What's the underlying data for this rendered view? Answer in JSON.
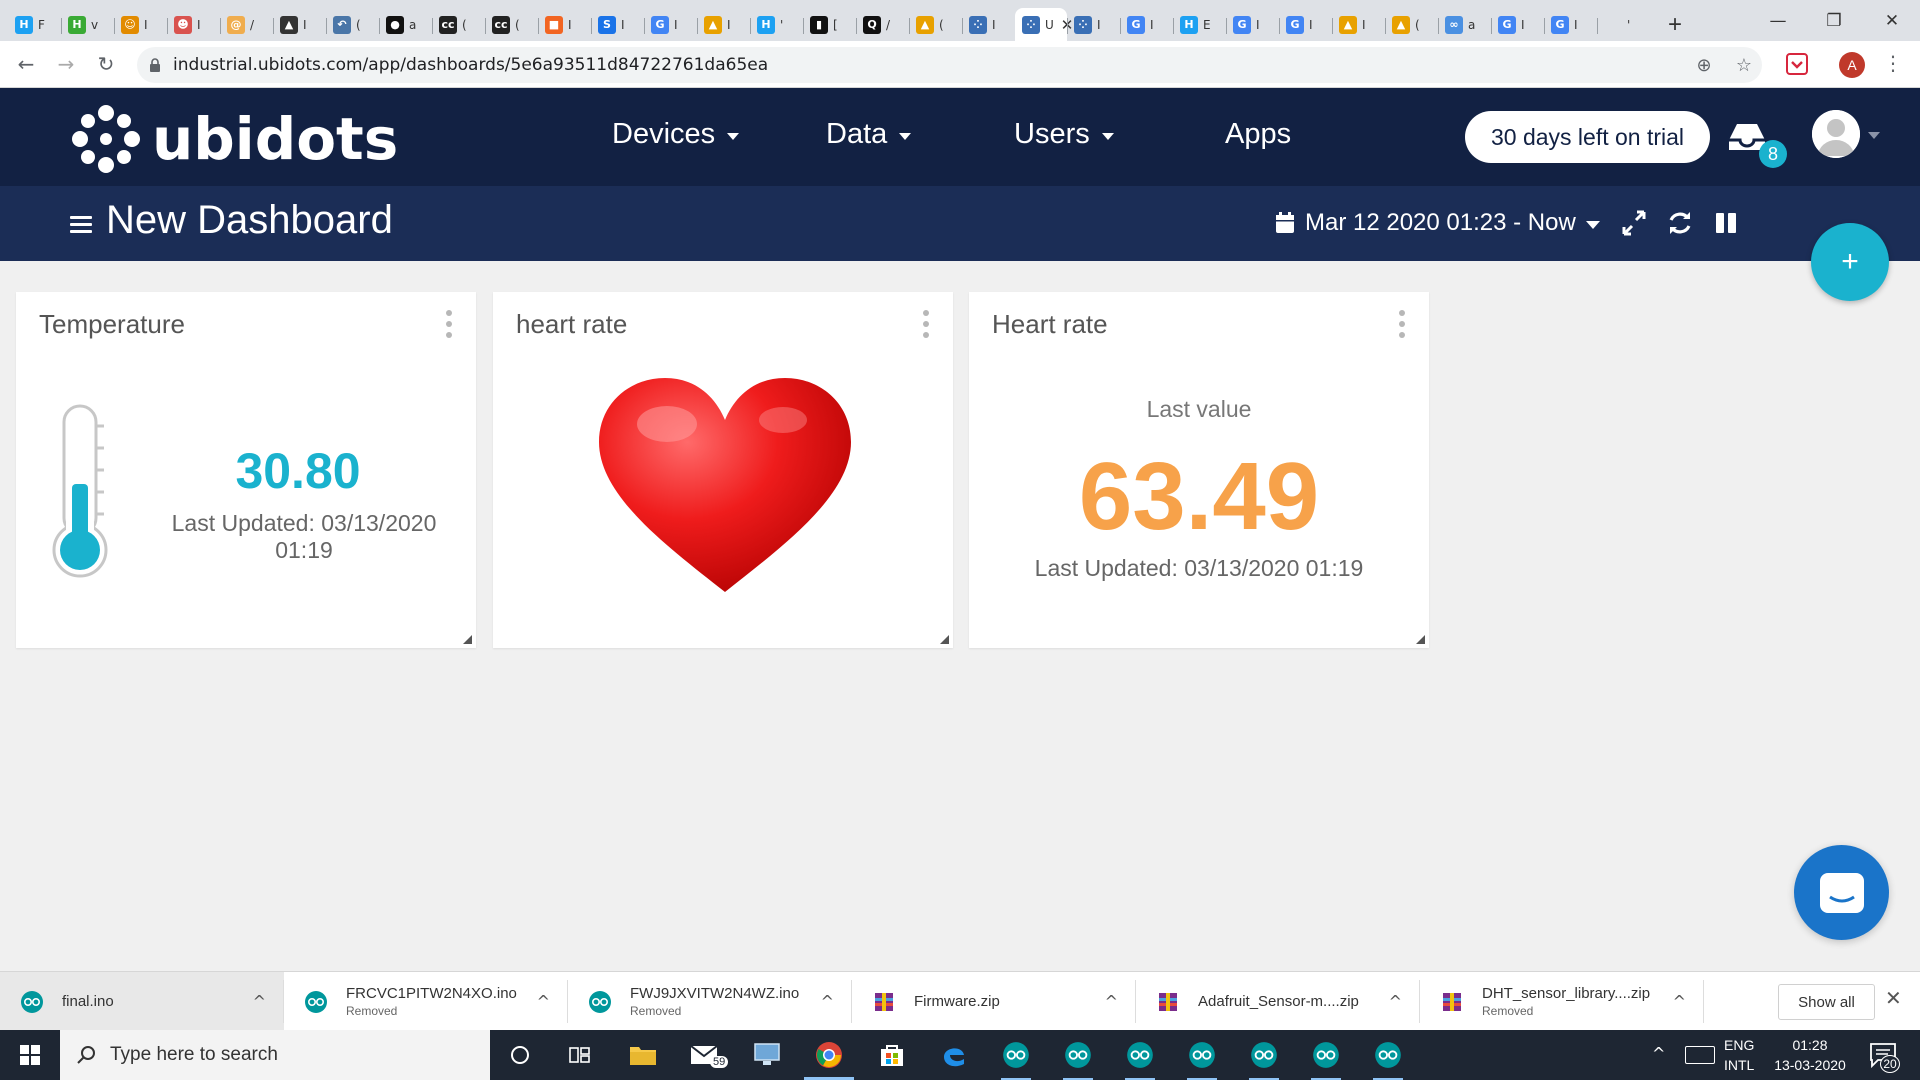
{
  "browser": {
    "active_tab_title": "U",
    "url": "industrial.ubidots.com/app/dashboards/5e6a93511d84722761da65ea",
    "profile_initial": "A",
    "tabs": [
      {
        "icon": "hash-icon",
        "color": "#1da1f2",
        "letter": "H",
        "text": "F"
      },
      {
        "icon": "h-icon",
        "color": "#3aaa35",
        "letter": "H",
        "text": "v"
      },
      {
        "icon": "face-icon",
        "color": "#e28b00",
        "letter": "☺",
        "text": "I"
      },
      {
        "icon": "brain-icon",
        "color": "#d9534f",
        "letter": "☻",
        "text": "I"
      },
      {
        "icon": "spiral-icon",
        "color": "#f0ad4e",
        "letter": "@",
        "text": "/"
      },
      {
        "icon": "grad-cap-icon",
        "color": "#333333",
        "letter": "▲",
        "text": "I"
      },
      {
        "icon": "bird-icon",
        "color": "#4a76a8",
        "letter": "↶",
        "text": "("
      },
      {
        "icon": "github-icon",
        "color": "#111111",
        "letter": "●",
        "text": "a"
      },
      {
        "icon": "cc-icon",
        "color": "#222222",
        "letter": "cc",
        "text": "("
      },
      {
        "icon": "cc-icon",
        "color": "#222222",
        "letter": "cc",
        "text": "("
      },
      {
        "icon": "gift-icon",
        "color": "#f26522",
        "letter": "■",
        "text": "I"
      },
      {
        "icon": "s-icon",
        "color": "#1a73e8",
        "letter": "S",
        "text": "I"
      },
      {
        "icon": "google-icon",
        "color": "#4285f4",
        "letter": "G",
        "text": "I"
      },
      {
        "icon": "helmet-icon",
        "color": "#e8a100",
        "letter": "▲",
        "text": "I"
      },
      {
        "icon": "hash-icon",
        "color": "#1da1f2",
        "letter": "H",
        "text": "'"
      },
      {
        "icon": "book-icon",
        "color": "#111111",
        "letter": "▮",
        "text": "["
      },
      {
        "icon": "magnifier-icon",
        "color": "#111111",
        "letter": "Q",
        "text": "/"
      },
      {
        "icon": "helmet-icon",
        "color": "#e8a100",
        "letter": "▲",
        "text": "("
      },
      {
        "icon": "ubidots-icon",
        "color": "#3a6fb5",
        "letter": "⁘",
        "text": "I"
      },
      {
        "icon": "ubidots-icon",
        "color": "#3a6fb5",
        "letter": "⁘",
        "text": "U",
        "active": true
      },
      {
        "icon": "ubidots-icon",
        "color": "#3a6fb5",
        "letter": "⁘",
        "text": "I"
      },
      {
        "icon": "google-icon",
        "color": "#4285f4",
        "letter": "G",
        "text": "I"
      },
      {
        "icon": "hash-icon",
        "color": "#1da1f2",
        "letter": "H",
        "text": "E"
      },
      {
        "icon": "google-icon",
        "color": "#4285f4",
        "letter": "G",
        "text": "I"
      },
      {
        "icon": "google-icon",
        "color": "#4285f4",
        "letter": "G",
        "text": "I"
      },
      {
        "icon": "helmet-icon",
        "color": "#e8a100",
        "letter": "▲",
        "text": "I"
      },
      {
        "icon": "helmet-icon",
        "color": "#e8a100",
        "letter": "▲",
        "text": "("
      },
      {
        "icon": "chat-icon",
        "color": "#4a90e2",
        "letter": "∞",
        "text": "a"
      },
      {
        "icon": "google-icon",
        "color": "#4285f4",
        "letter": "G",
        "text": "I"
      },
      {
        "icon": "google-icon",
        "color": "#4285f4",
        "letter": "G",
        "text": "I"
      },
      {
        "icon": "blank-icon",
        "color": "#dee1e6",
        "letter": "",
        "text": "'"
      }
    ]
  },
  "ubidots": {
    "logo_text": "ubidots",
    "nav": {
      "devices": "Devices",
      "data": "Data",
      "users": "Users",
      "apps": "Apps"
    },
    "trial": "30 days left on trial",
    "notifications": "8",
    "dashboard_title": "New Dashboard",
    "date_range": "Mar 12 2020 01:23 - Now",
    "fab": "+"
  },
  "widgets": {
    "temperature": {
      "title": "Temperature",
      "value": "30.80",
      "updated": "Last Updated: 03/13/2020 01:19",
      "color": "#1ab2ce"
    },
    "heart_image": {
      "title": "heart rate"
    },
    "heart_rate": {
      "title": "Heart rate",
      "label": "Last value",
      "value": "63.49",
      "updated": "Last Updated: 03/13/2020 01:19",
      "color": "#f7a24a"
    }
  },
  "downloads": {
    "items": [
      {
        "name": "final.ino",
        "status": "",
        "icon": "arduino-icon"
      },
      {
        "name": "FRCVC1PITW2N4XO.ino",
        "status": "Removed",
        "icon": "arduino-icon"
      },
      {
        "name": "FWJ9JXVITW2N4WZ.ino",
        "status": "Removed",
        "icon": "arduino-icon"
      },
      {
        "name": "Firmware.zip",
        "status": "",
        "icon": "winrar-icon"
      },
      {
        "name": "Adafruit_Sensor-m....zip",
        "status": "",
        "icon": "winrar-icon"
      },
      {
        "name": "DHT_sensor_library....zip",
        "status": "Removed",
        "icon": "winrar-icon"
      }
    ],
    "show_all": "Show all"
  },
  "taskbar": {
    "search_placeholder": "Type here to search",
    "mail_badge": "59",
    "lang_line1": "ENG",
    "lang_line2": "INTL",
    "time": "01:28",
    "date": "13-03-2020",
    "notification_count": "20"
  }
}
